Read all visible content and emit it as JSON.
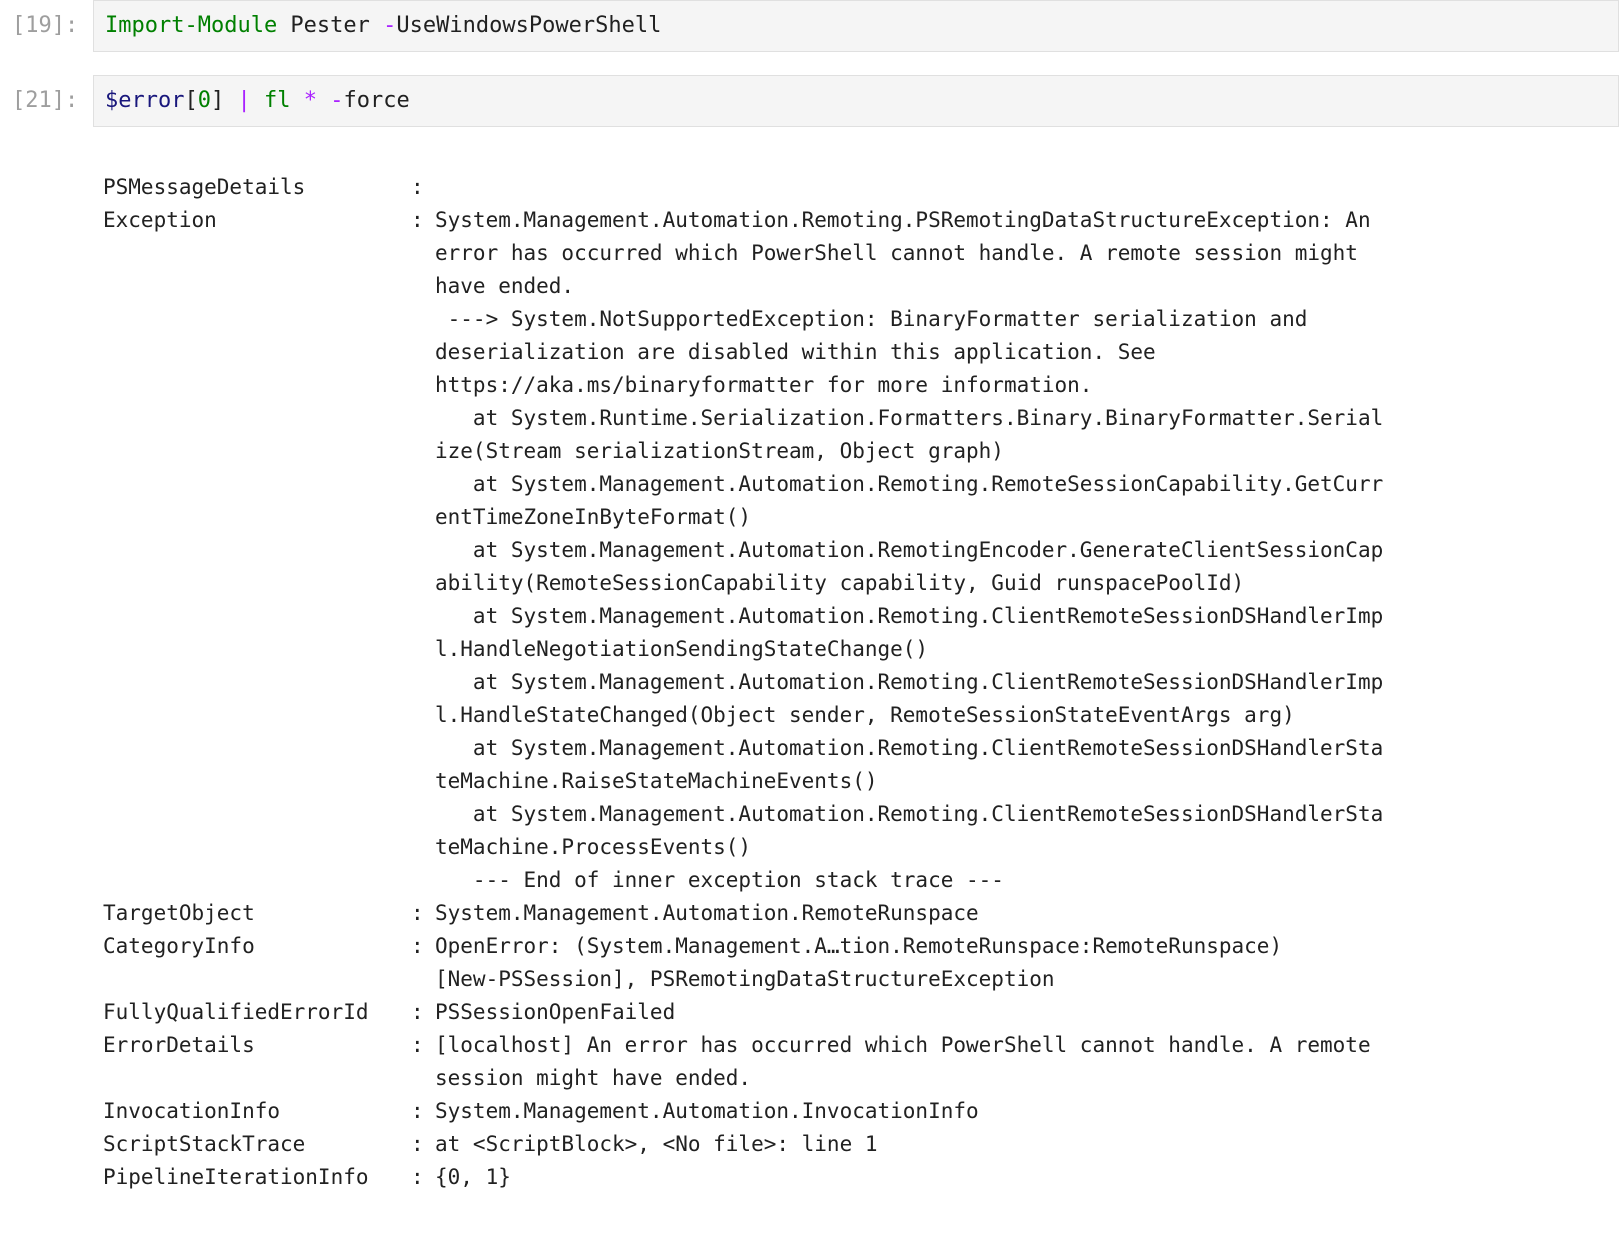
{
  "cells": [
    {
      "prompt": "[19]:",
      "tokens": [
        {
          "cls": "tok-cmd",
          "text": "Import-Module"
        },
        {
          "cls": "tok-param",
          "text": " Pester "
        },
        {
          "cls": "tok-dash",
          "text": "-"
        },
        {
          "cls": "tok-param",
          "text": "UseWindowsPowerShell"
        }
      ]
    },
    {
      "prompt": "[21]:",
      "tokens": [
        {
          "cls": "tok-var",
          "text": "$error"
        },
        {
          "cls": "tok-param",
          "text": "["
        },
        {
          "cls": "tok-num",
          "text": "0"
        },
        {
          "cls": "tok-param",
          "text": "] "
        },
        {
          "cls": "tok-op",
          "text": "|"
        },
        {
          "cls": "tok-param",
          "text": " "
        },
        {
          "cls": "tok-cmd",
          "text": "fl"
        },
        {
          "cls": "tok-param",
          "text": " "
        },
        {
          "cls": "tok-op",
          "text": "*"
        },
        {
          "cls": "tok-param",
          "text": " "
        },
        {
          "cls": "tok-dash",
          "text": "-"
        },
        {
          "cls": "tok-param",
          "text": "force"
        }
      ]
    }
  ],
  "output": {
    "separator": ":",
    "rows": [
      {
        "key": "PSMessageDetails",
        "lines": [
          ""
        ]
      },
      {
        "key": "Exception",
        "lines": [
          "System.Management.Automation.Remoting.PSRemotingDataStructureException: An",
          "error has occurred which PowerShell cannot handle. A remote session might",
          "have ended.",
          " ---> System.NotSupportedException: BinaryFormatter serialization and",
          "deserialization are disabled within this application. See",
          "https://aka.ms/binaryformatter for more information.",
          "   at System.Runtime.Serialization.Formatters.Binary.BinaryFormatter.Serial",
          "ize(Stream serializationStream, Object graph)",
          "   at System.Management.Automation.Remoting.RemoteSessionCapability.GetCurr",
          "entTimeZoneInByteFormat()",
          "   at System.Management.Automation.RemotingEncoder.GenerateClientSessionCap",
          "ability(RemoteSessionCapability capability, Guid runspacePoolId)",
          "   at System.Management.Automation.Remoting.ClientRemoteSessionDSHandlerImp",
          "l.HandleNegotiationSendingStateChange()",
          "   at System.Management.Automation.Remoting.ClientRemoteSessionDSHandlerImp",
          "l.HandleStateChanged(Object sender, RemoteSessionStateEventArgs arg)",
          "   at System.Management.Automation.Remoting.ClientRemoteSessionDSHandlerSta",
          "teMachine.RaiseStateMachineEvents()",
          "   at System.Management.Automation.Remoting.ClientRemoteSessionDSHandlerSta",
          "teMachine.ProcessEvents()",
          "   --- End of inner exception stack trace ---"
        ]
      },
      {
        "key": "TargetObject",
        "lines": [
          "System.Management.Automation.RemoteRunspace"
        ]
      },
      {
        "key": "CategoryInfo",
        "lines": [
          "OpenError: (System.Management.A…tion.RemoteRunspace:RemoteRunspace)",
          "[New-PSSession], PSRemotingDataStructureException"
        ]
      },
      {
        "key": "FullyQualifiedErrorId",
        "lines": [
          "PSSessionOpenFailed"
        ]
      },
      {
        "key": "ErrorDetails",
        "lines": [
          "[localhost] An error has occurred which PowerShell cannot handle. A remote",
          "session might have ended."
        ]
      },
      {
        "key": "InvocationInfo",
        "lines": [
          "System.Management.Automation.InvocationInfo"
        ]
      },
      {
        "key": "ScriptStackTrace",
        "lines": [
          "at <ScriptBlock>, <No file>: line 1"
        ]
      },
      {
        "key": "PipelineIterationInfo",
        "lines": [
          "{0, 1}"
        ]
      }
    ]
  }
}
